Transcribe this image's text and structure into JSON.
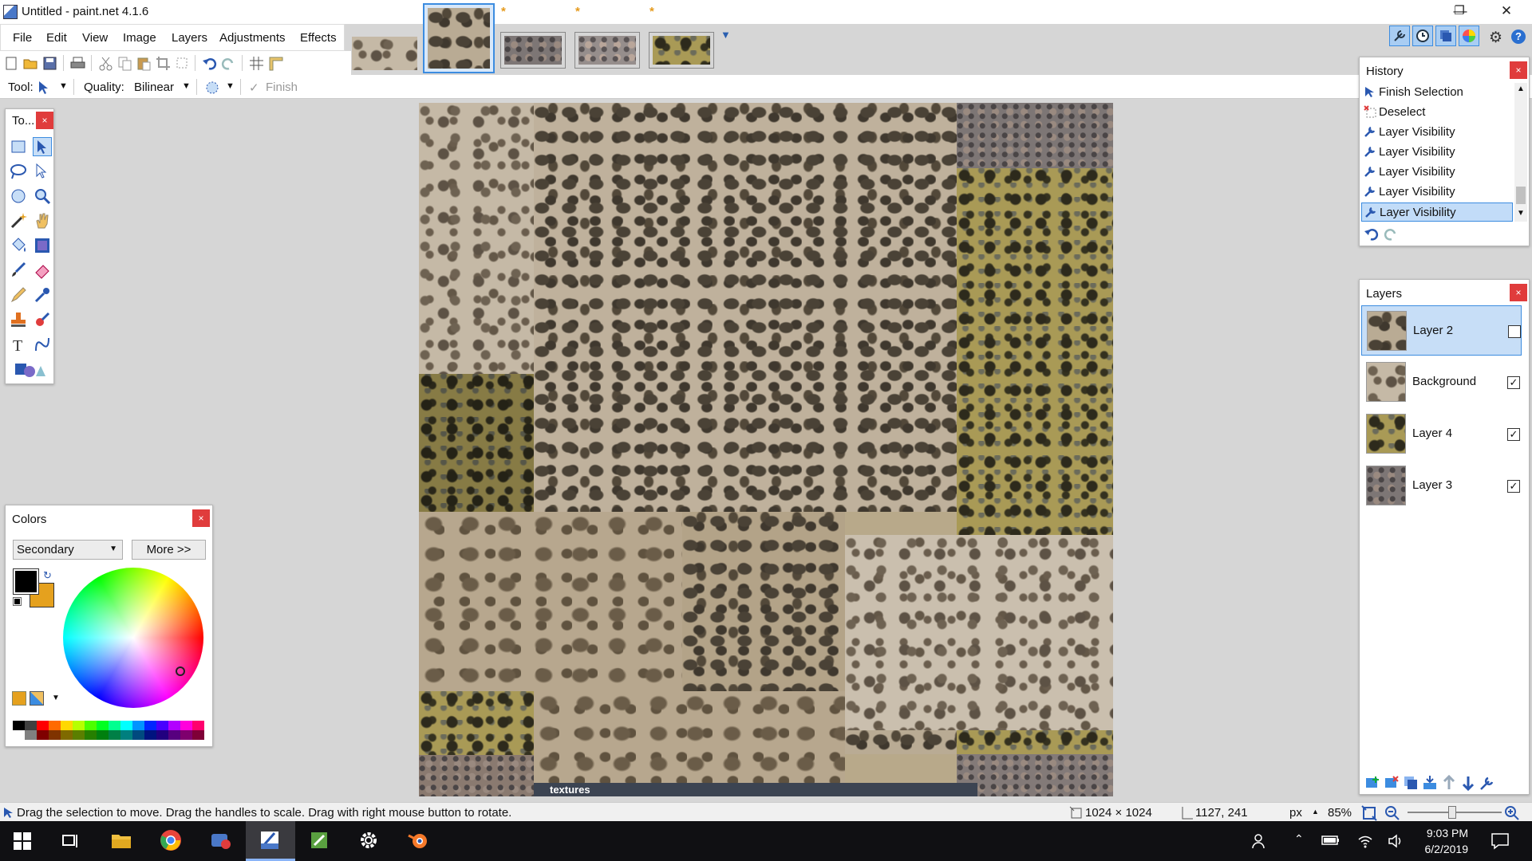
{
  "window": {
    "title": "Untitled - paint.net 4.1.6",
    "minimize": "—",
    "restore": "❐",
    "close": "✕"
  },
  "menu": [
    "File",
    "Edit",
    "View",
    "Image",
    "Layers",
    "Adjustments",
    "Effects"
  ],
  "image_tabs": {
    "unsaved_marker": "*",
    "overflow_icon": "chevron-down-icon"
  },
  "toolbar": {
    "tool_label": "Tool:",
    "quality_label": "Quality:",
    "quality_value": "Bilinear",
    "finish_label": "Finish"
  },
  "tools_panel": {
    "title": "To...",
    "close": "×",
    "tools": [
      "rectangle-select",
      "move-selection",
      "lasso-select",
      "move-selection-outline",
      "ellipse-select",
      "zoom",
      "magic-wand",
      "pan",
      "paint-bucket",
      "gradient",
      "paintbrush",
      "eraser",
      "pencil",
      "color-picker",
      "clone-stamp",
      "recolor",
      "text",
      "line-curve",
      "shapes"
    ]
  },
  "history_panel": {
    "title": "History",
    "close": "×",
    "items": [
      {
        "label": "Finish Selection",
        "icon": "finish-selection-icon"
      },
      {
        "label": "Deselect",
        "icon": "deselect-icon"
      },
      {
        "label": "Layer Visibility",
        "icon": "wrench-icon"
      },
      {
        "label": "Layer Visibility",
        "icon": "wrench-icon"
      },
      {
        "label": "Layer Visibility",
        "icon": "wrench-icon"
      },
      {
        "label": "Layer Visibility",
        "icon": "wrench-icon"
      },
      {
        "label": "Layer Visibility",
        "icon": "wrench-icon",
        "selected": true
      }
    ]
  },
  "layers_panel": {
    "title": "Layers",
    "close": "×",
    "layers": [
      {
        "name": "Layer 2",
        "visible": false,
        "selected": true
      },
      {
        "name": "Background",
        "visible": true
      },
      {
        "name": "Layer 4",
        "visible": true
      },
      {
        "name": "Layer 3",
        "visible": true
      }
    ],
    "check_mark": "✓"
  },
  "colors_panel": {
    "title": "Colors",
    "close": "×",
    "mode_value": "Secondary",
    "more_label": "More >>",
    "primary_color": "#000000",
    "secondary_color": "#e5a11e",
    "palette": [
      "#000000",
      "#404040",
      "#ff0000",
      "#ff6a00",
      "#ffd800",
      "#b6ff00",
      "#4cff00",
      "#00ff21",
      "#00ff90",
      "#00ffff",
      "#0094ff",
      "#0026ff",
      "#4800ff",
      "#b200ff",
      "#ff00dc",
      "#ff006e"
    ],
    "palette_dark": [
      "#ffffff",
      "#808080",
      "#7f0000",
      "#7f3300",
      "#7f6a00",
      "#5b7f00",
      "#267f00",
      "#007f0e",
      "#007f46",
      "#007f7f",
      "#004a7f",
      "#00137f",
      "#21007f",
      "#57007f",
      "#7f006e",
      "#7f0037"
    ]
  },
  "statusbar": {
    "hint": "Drag the selection to move. Drag the handles to scale. Drag with right mouse button to rotate.",
    "image_size": "1024 × 1024",
    "cursor_pos": "1127, 241",
    "units": "px",
    "zoom": "85%"
  },
  "taskbar": {
    "time": "9:03 PM",
    "date": "6/2/2019"
  },
  "canvas": {
    "watermark": "textures"
  },
  "colors": {
    "accent": "#3c8ce0",
    "close_red": "#e03c3c"
  }
}
